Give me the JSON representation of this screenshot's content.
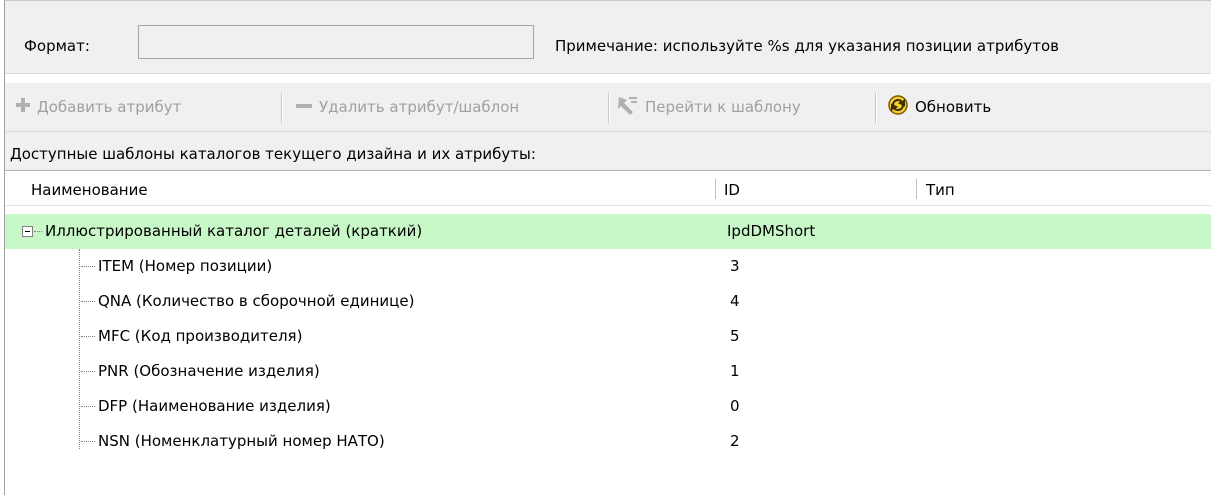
{
  "format": {
    "label": "Формат:",
    "value": "",
    "placeholder": "",
    "note": "Примечание: используйте %s для указания позиции атрибутов"
  },
  "toolbar": {
    "add_label": "Добавить атрибут",
    "delete_label": "Удалить атрибут/шаблон",
    "goto_label": "Перейти к шаблону",
    "refresh_label": "Обновить"
  },
  "caption": "Доступные шаблоны каталогов текущего дизайна и их атрибуты:",
  "grid": {
    "columns": {
      "name": "Наименование",
      "id": "ID",
      "type": "Тип"
    },
    "root": {
      "name": "Иллюстрированный каталог деталей (краткий)",
      "id": "IpdDMShort",
      "type": ""
    },
    "children": [
      {
        "name": "ITEM (Номер позиции)",
        "id": "3"
      },
      {
        "name": "QNA (Количество в сборочной единице)",
        "id": "4"
      },
      {
        "name": "MFC (Код производителя)",
        "id": "5"
      },
      {
        "name": "PNR (Обозначение изделия)",
        "id": "1"
      },
      {
        "name": "DFP (Наименование изделия)",
        "id": "0"
      },
      {
        "name": "NSN (Номенклатурный номер НАТО)",
        "id": "2"
      }
    ]
  },
  "colors": {
    "selected_row": "#c8f7c8",
    "disabled_text": "#a0a0a0",
    "refresh_icon": "#e0b000"
  },
  "icons": {
    "add": "plus-icon",
    "delete": "minus-icon",
    "goto": "goto-template-icon",
    "refresh": "refresh-icon",
    "expander": "collapse-icon"
  }
}
